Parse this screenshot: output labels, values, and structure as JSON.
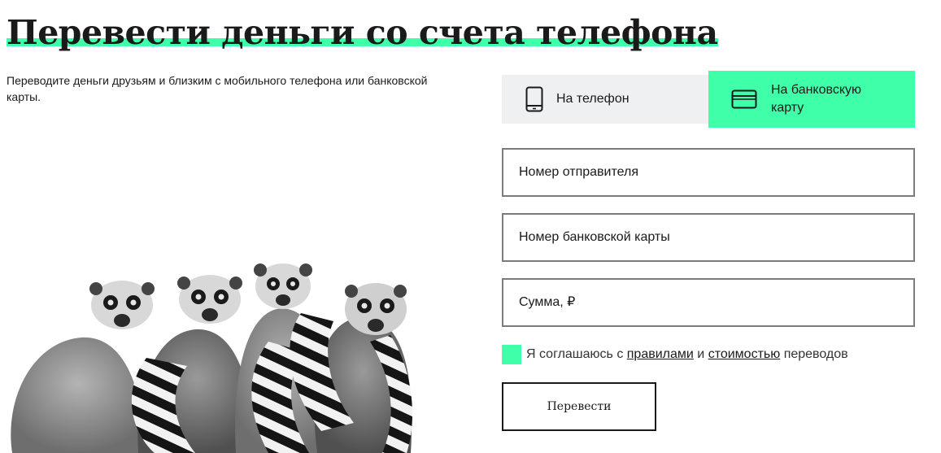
{
  "page": {
    "title": "Перевести деньги со счета телефона",
    "subtitle": "Переводите деньги друзьям и близким с мобильного телефона или банковской карты."
  },
  "tabs": [
    {
      "label": "На телефон",
      "icon": "smartphone-icon",
      "active": false
    },
    {
      "label": "На банковскую карту",
      "icon": "credit-card-icon",
      "active": true
    }
  ],
  "form": {
    "sender_placeholder": "Номер отправителя",
    "card_placeholder": "Номер банковской карты",
    "sum_placeholder": "Сумма, ₽",
    "agreement": {
      "prefix": "Я соглашаюсь с",
      "rules_link": "правилами",
      "and": "и",
      "cost_link": "стоимостью",
      "suffix": "переводов"
    },
    "submit_label": "Перевести"
  },
  "colors": {
    "accent": "#3fffa8",
    "tab_inactive_bg": "#eff0f2",
    "field_border": "#7c7c7c",
    "text": "#1a1a1a"
  }
}
